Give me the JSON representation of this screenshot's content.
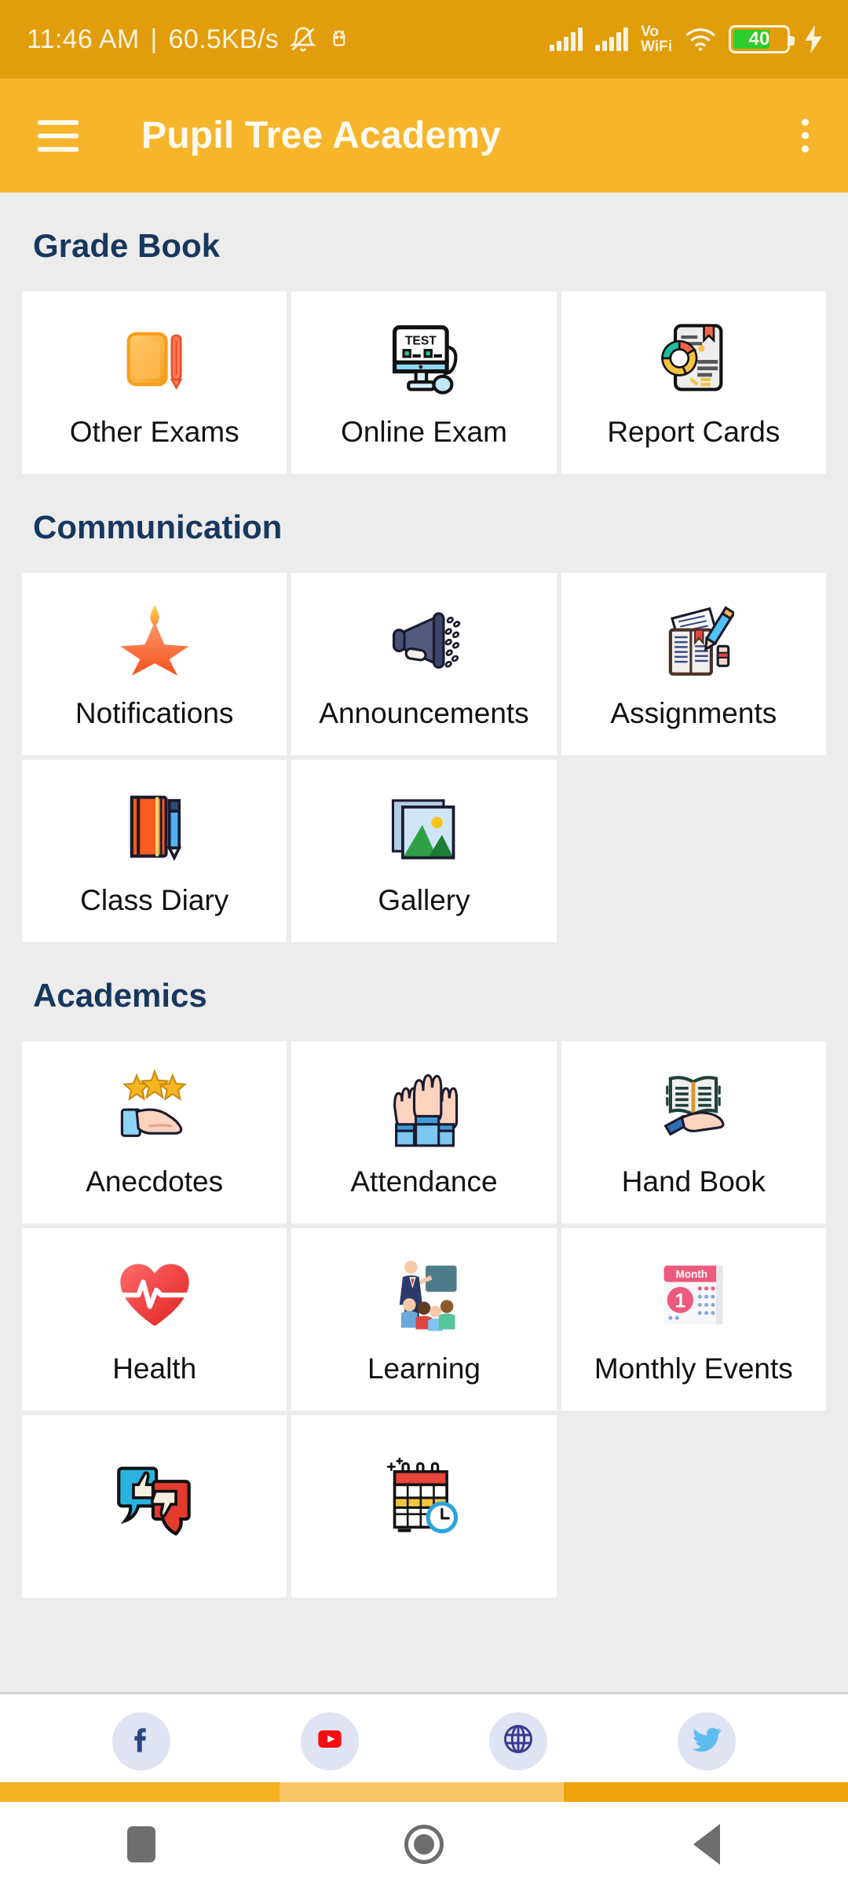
{
  "status_bar": {
    "time": "11:46 AM",
    "separator": "|",
    "network_speed": "60.5KB/s",
    "silent_icon": "bell-muted-icon",
    "android_icon": "android-debug-icon",
    "vo_label": "Vo",
    "wifi_label": "WiFi",
    "battery_percent": "40",
    "charging_icon": "charging-bolt-icon"
  },
  "app_bar": {
    "menu_icon": "hamburger-menu-icon",
    "title": "Pupil Tree Academy",
    "overflow_icon": "more-vertical-icon"
  },
  "sections": [
    {
      "title": "Grade Book",
      "items": [
        {
          "label": "Other Exams",
          "icon": "notebook-pencil-icon"
        },
        {
          "label": "Online Exam",
          "icon": "test-monitor-icon"
        },
        {
          "label": "Report Cards",
          "icon": "report-chart-icon"
        }
      ]
    },
    {
      "title": "Communication",
      "items": [
        {
          "label": "Notifications",
          "icon": "star-flame-icon"
        },
        {
          "label": "Announcements",
          "icon": "megaphone-icon"
        },
        {
          "label": "Assignments",
          "icon": "papers-pencil-icon"
        },
        {
          "label": "Class Diary",
          "icon": "diary-book-pen-icon"
        },
        {
          "label": "Gallery",
          "icon": "photo-stack-icon"
        }
      ]
    },
    {
      "title": "Academics",
      "items": [
        {
          "label": "Anecdotes",
          "icon": "hand-stars-icon"
        },
        {
          "label": "Attendance",
          "icon": "raised-hands-icon"
        },
        {
          "label": "Hand Book",
          "icon": "open-book-hand-icon"
        },
        {
          "label": "Health",
          "icon": "heart-pulse-icon"
        },
        {
          "label": "Learning",
          "icon": "teacher-class-icon"
        },
        {
          "label": "Monthly Events",
          "icon": "calendar-month-icon"
        },
        {
          "label": "",
          "icon": "feedback-bubbles-icon"
        },
        {
          "label": "",
          "icon": "timetable-clock-icon"
        }
      ]
    }
  ],
  "social_links": [
    {
      "name": "facebook",
      "icon": "facebook-icon"
    },
    {
      "name": "youtube",
      "icon": "youtube-icon"
    },
    {
      "name": "website",
      "icon": "globe-icon"
    },
    {
      "name": "twitter",
      "icon": "twitter-icon"
    }
  ],
  "nav_bar": {
    "recents": "recents-button",
    "home": "home-button",
    "back": "back-button"
  },
  "colors": {
    "status_bar": "#E29D0B",
    "app_bar": "#F7B52B",
    "section_title": "#17375E",
    "page_background": "#ececec",
    "card": "#ffffff",
    "battery_fill": "#2ECC2E"
  }
}
